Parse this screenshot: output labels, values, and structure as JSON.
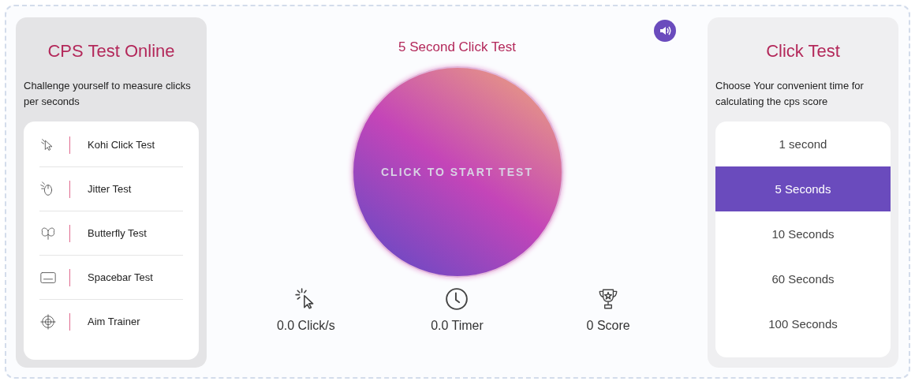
{
  "left_panel": {
    "title": "CPS Test Online",
    "description": "Challenge yourself to measure clicks per seconds",
    "tests": [
      {
        "label": "Kohi Click Test"
      },
      {
        "label": "Jitter Test"
      },
      {
        "label": "Butterfly Test"
      },
      {
        "label": "Spacebar Test"
      },
      {
        "label": "Aim Trainer"
      }
    ]
  },
  "center": {
    "title": "5 Second Click Test",
    "start_button": "CLICK TO START TEST",
    "stats": [
      {
        "kind": "clicks",
        "label": "0.0 Click/s"
      },
      {
        "kind": "timer",
        "label": "0.0 Timer"
      },
      {
        "kind": "score",
        "label": "0 Score"
      }
    ]
  },
  "right_panel": {
    "title": "Click Test",
    "description": "Choose Your convenient time for calculating the cps score",
    "durations": [
      {
        "label": "1 second",
        "selected": false
      },
      {
        "label": "5 Seconds",
        "selected": true
      },
      {
        "label": "10 Seconds",
        "selected": false
      },
      {
        "label": "60 Seconds",
        "selected": false
      },
      {
        "label": "100 Seconds",
        "selected": false
      }
    ]
  }
}
